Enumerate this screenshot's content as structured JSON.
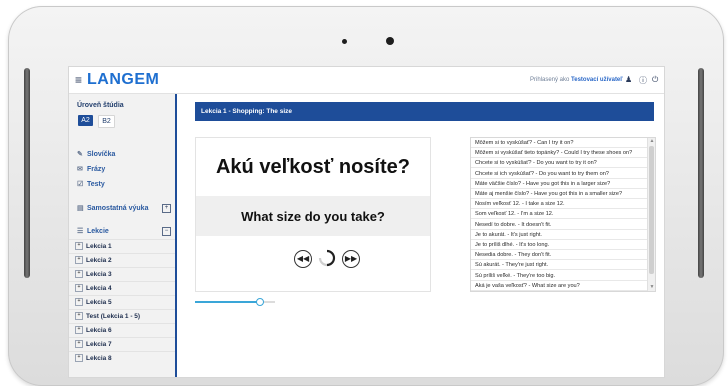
{
  "app": {
    "logo": "LANGEM"
  },
  "header": {
    "login_prefix": "Prihlasený ako",
    "user_name": "Testovací užívateľ",
    "icons": [
      "user-icon",
      "help-icon",
      "power-icon"
    ]
  },
  "sidebar": {
    "level_heading": "Úroveň štúdia",
    "levels": [
      {
        "label": "A2",
        "active": true
      },
      {
        "label": "B2",
        "active": false
      }
    ],
    "menu": [
      {
        "label": "Slovíčka",
        "icon": "pencil-icon"
      },
      {
        "label": "Frázy",
        "icon": "chat-icon"
      },
      {
        "label": "Testy",
        "icon": "checkbox-icon"
      }
    ],
    "self_study": "Samostatná výuka",
    "lessons_heading": "Lekcie",
    "lessons": [
      "Lekcia 1",
      "Lekcia 2",
      "Lekcia 3",
      "Lekcia 4",
      "Lekcia 5",
      "Test (Lekcia 1 - 5)",
      "Lekcia 6",
      "Lekcia 7",
      "Lekcia 8"
    ]
  },
  "main": {
    "lesson_title": "Lekcia 1 - Shopping: The size",
    "card": {
      "question": "Akú veľkosť nosíte?",
      "answer": "What size do you take?"
    },
    "controls": [
      "previous-icon",
      "loading-icon",
      "next-icon"
    ],
    "progress": 0.8,
    "phrases": [
      "Môžem si to vyskúšať? - Can I try it on?",
      "Môžem si vyskúšať tieto topánky? - Could I try these shoes on?",
      "Chcete si to vyskúšať? - Do you want to try it on?",
      "Chcete si ich vyskúšať? - Do you want to try them on?",
      "Máte väčšie číslo? - Have you got this in a larger size?",
      "Máte aj menšie číslo? - Have you got this in a smaller size?",
      "Nosím veľkosť 12. - I take a size 12.",
      "Som veľkosť 12. - I'm a size 12.",
      "Nesedí to dobre. - It doesn't fit.",
      "Je to akurát. - It's just right.",
      "Je to príliš dlhé. - It's too long.",
      "Nesedia dobre. - They don't fit.",
      "Sú akurát. - They're just right.",
      "Sú príliš veľké. - They're too big.",
      "Aká je vaša veľkosť? - What size are you?"
    ]
  },
  "colors": {
    "brand": "#1e4d99",
    "logo": "#1e6fd0",
    "progress": "#3aa6d8"
  }
}
